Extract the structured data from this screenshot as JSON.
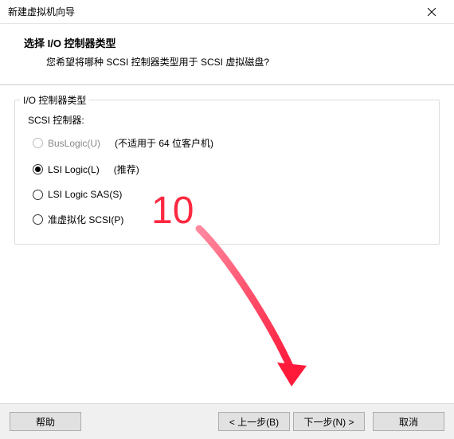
{
  "window": {
    "title": "新建虚拟机向导"
  },
  "header": {
    "title": "选择 I/O 控制器类型",
    "subtitle": "您希望将哪种 SCSI 控制器类型用于 SCSI 虚拟磁盘?"
  },
  "group": {
    "legend": "I/O 控制器类型",
    "scsi_label": "SCSI 控制器:"
  },
  "options": {
    "buslogic": {
      "label": "BusLogic(U)",
      "hint": "(不适用于 64 位客户机)"
    },
    "lsi": {
      "label": "LSI Logic(L)",
      "hint": "(推荐)"
    },
    "lsisas": {
      "label": "LSI Logic SAS(S)"
    },
    "pv": {
      "label": "准虚拟化 SCSI(P)"
    }
  },
  "annotation": {
    "number": "10"
  },
  "buttons": {
    "help": "帮助",
    "back": "< 上一步(B)",
    "next": "下一步(N) >",
    "cancel": "取消"
  }
}
